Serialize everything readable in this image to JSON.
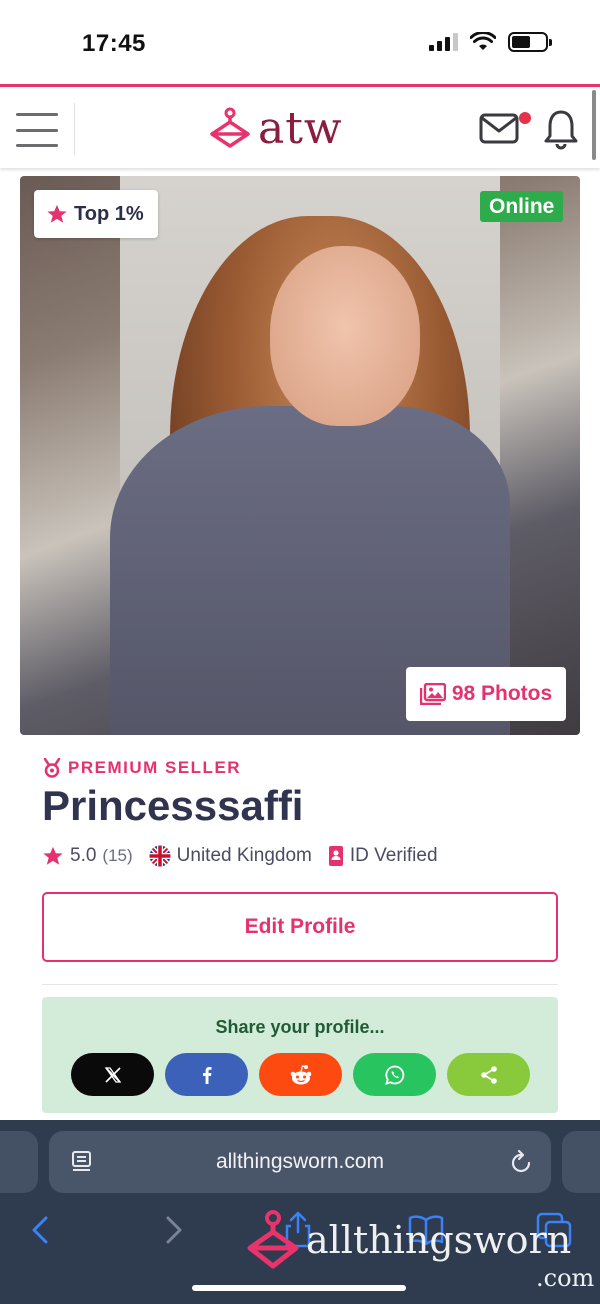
{
  "status_bar": {
    "time": "17:45"
  },
  "header": {
    "logo_text": "atw",
    "menu_icon": "hamburger-icon",
    "mail_icon": "envelope-icon",
    "bell_icon": "bell-icon",
    "accent_color": "#e8336d",
    "logo_color": "#8b1e3f"
  },
  "profile_photo": {
    "top_badge": "Top 1%",
    "online_badge": "Online",
    "photos_button": "98 Photos"
  },
  "profile": {
    "seller_tier": "PREMIUM SELLER",
    "username": "Princesssaffi",
    "rating": "5.0",
    "review_count": "(15)",
    "country": "United Kingdom",
    "verification": "ID Verified",
    "edit_button": "Edit Profile"
  },
  "share": {
    "title": "Share your profile...",
    "buttons": [
      "x",
      "facebook",
      "reddit",
      "whatsapp",
      "share"
    ]
  },
  "browser": {
    "url": "allthingsworn.com",
    "watermark": "allthingsworn",
    "watermark_suffix": ".com"
  }
}
